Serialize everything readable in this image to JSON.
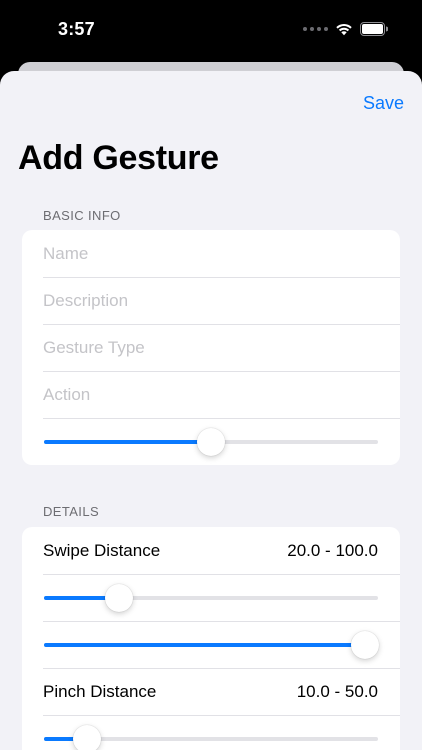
{
  "status_bar": {
    "time": "3:57",
    "icons": [
      "signal-dots-icon",
      "wifi-icon",
      "battery-icon"
    ]
  },
  "nav": {
    "save_label": "Save",
    "title": "Add Gesture"
  },
  "basic_info": {
    "header": "BASIC INFO",
    "fields": [
      {
        "name": "name",
        "value": "",
        "placeholder": "Name"
      },
      {
        "name": "description",
        "value": "",
        "placeholder": "Description"
      },
      {
        "name": "gesture-type",
        "value": "",
        "placeholder": "Gesture Type"
      },
      {
        "name": "action",
        "value": "",
        "placeholder": "Action"
      }
    ],
    "slider_value": 0.5
  },
  "details": {
    "header": "DETAILS",
    "swipe": {
      "label": "Swipe Distance",
      "value": "20.0 - 100.0",
      "lower_fraction": 0.225,
      "upper_fraction": 0.96
    },
    "pinch": {
      "label": "Pinch Distance",
      "value": "10.0 - 50.0",
      "lower_fraction": 0.13
    }
  },
  "colors": {
    "accent": "#0a7aff",
    "background": "#f2f2f7",
    "card": "#ffffff",
    "placeholder": "#c4c4c8",
    "section_header": "#6d6d72"
  }
}
